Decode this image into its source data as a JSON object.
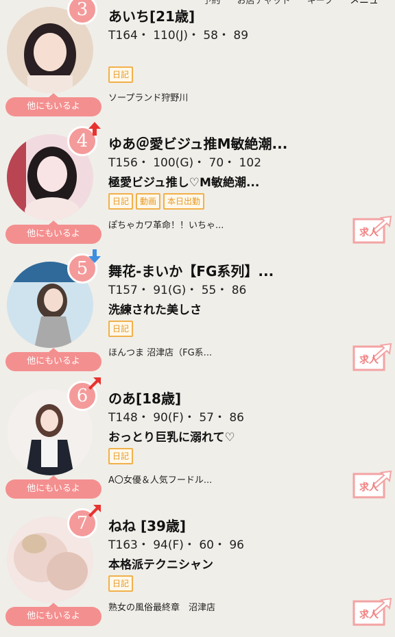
{
  "header": {
    "links": [
      "予約",
      "お店チャット",
      "キープ"
    ],
    "menu_label": "メニュー"
  },
  "others_label": "他にもいるよ",
  "job_label": "求人",
  "cards": [
    {
      "rank": "3",
      "arrow": "none",
      "name": "あいち[21歳]",
      "specs": "T164・ 110(J)・ 58・ 89",
      "catch": "",
      "badges": [
        "日記"
      ],
      "shop": "ソープランド狩野川",
      "has_job": false
    },
    {
      "rank": "4",
      "arrow": "up",
      "name": "ゆあ＠愛ビジュ推M敏絶潮...",
      "specs": "T156・ 100(G)・ 70・ 102",
      "catch": "極愛ビジュ推し♡M敏絶潮...",
      "badges": [
        "日記",
        "動画",
        "本日出勤"
      ],
      "shop": "ぽちゃカワ革命！！いちゃ...",
      "has_job": true
    },
    {
      "rank": "5",
      "arrow": "down",
      "name": "舞花-まいか【FG系列】...",
      "specs": "T157・ 91(G)・ 55・ 86",
      "catch": "洗練された美しさ",
      "badges": [
        "日記"
      ],
      "shop": "ほんつま 沼津店（FG系...",
      "has_job": true
    },
    {
      "rank": "6",
      "arrow": "up-right",
      "name": "のあ[18歳]",
      "specs": "T148・ 90(F)・ 57・ 86",
      "catch": "おっとり巨乳に溺れて♡",
      "badges": [
        "日記"
      ],
      "shop": "A〇女優＆人気フードル...",
      "has_job": true
    },
    {
      "rank": "7",
      "arrow": "up-right",
      "name": "ねね [39歳]",
      "specs": "T163・ 94(F)・ 60・ 96",
      "catch": "本格派テクニシャン",
      "badges": [
        "日記"
      ],
      "shop": "熟女の風俗最終章　沼津店",
      "has_job": true
    }
  ],
  "colors": {
    "background": "#f0eee9",
    "rank_badge": "#f49a9a",
    "others_button": "#f48f8f",
    "badge_border": "#f1b04a",
    "arrow_up": "#e8322f",
    "arrow_down": "#3d8fe0"
  }
}
